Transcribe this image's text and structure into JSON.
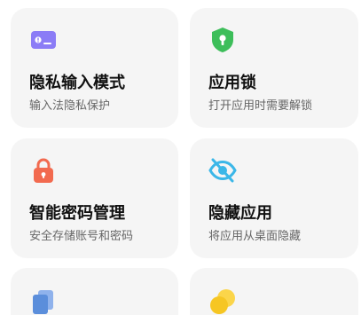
{
  "cards": [
    {
      "title": "隐私输入模式",
      "subtitle": "输入法隐私保护",
      "icon": "keyboard-privacy-icon",
      "color": "#8B7CF6"
    },
    {
      "title": "应用锁",
      "subtitle": "打开应用时需要解锁",
      "icon": "shield-lock-icon",
      "color": "#3DBE5A"
    },
    {
      "title": "智能密码管理",
      "subtitle": "安全存储账号和密码",
      "icon": "padlock-icon",
      "color": "#F26A4F"
    },
    {
      "title": "隐藏应用",
      "subtitle": "将应用从桌面隐藏",
      "icon": "eye-off-icon",
      "color": "#3BB7E8"
    },
    {
      "icon": "clone-apps-icon",
      "color": "#5B8EDB"
    },
    {
      "icon": "coins-icon",
      "color": "#F6C623"
    }
  ]
}
